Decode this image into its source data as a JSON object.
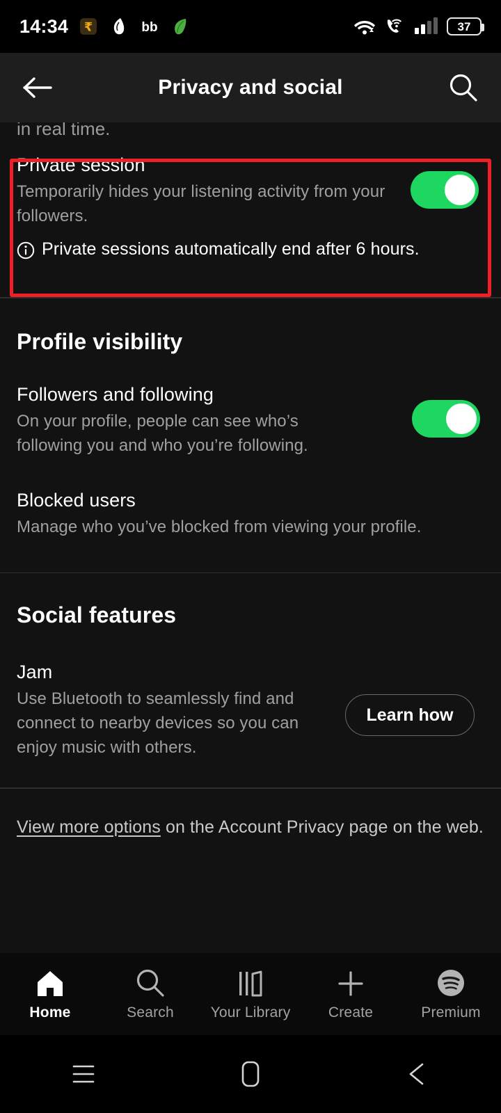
{
  "status_bar": {
    "time": "14:34",
    "left_icons": [
      "rupee-payment-icon",
      "thread-app-icon",
      "bb-app-icon",
      "leaf-app-icon"
    ],
    "right_icons": [
      "wifi-icon",
      "call-wifi-icon",
      "cellular-signal-icon"
    ],
    "battery_percent": "37"
  },
  "app_bar": {
    "back_icon": "back-arrow-icon",
    "title": "Privacy and social",
    "search_icon": "search-icon"
  },
  "content": {
    "clipped_text": "in real time.",
    "private_session": {
      "title": "Private session",
      "description": "Temporarily hides your listening activity from your followers.",
      "note": "Private sessions automatically end after 6 hours.",
      "note_icon": "info-icon",
      "toggle_on": true
    },
    "highlight_color": "#ee1f26",
    "profile_visibility": {
      "heading": "Profile visibility",
      "followers": {
        "title": "Followers and following",
        "description": "On your profile, people can see who’s following you and who you’re following.",
        "toggle_on": true
      },
      "blocked": {
        "title": "Blocked users",
        "description": "Manage who you’ve blocked from viewing your profile."
      }
    },
    "social_features": {
      "heading": "Social features",
      "jam": {
        "title": "Jam",
        "description": "Use Bluetooth to seamlessly find and connect to nearby devices so you can enjoy music with others.",
        "button_label": "Learn how"
      }
    },
    "footer": {
      "link_text": "View more options",
      "rest_text": " on the Account Privacy page on the web."
    }
  },
  "tab_bar": {
    "items": [
      {
        "label": "Home",
        "icon": "home-icon",
        "active": true
      },
      {
        "label": "Search",
        "icon": "search-icon",
        "active": false
      },
      {
        "label": "Your Library",
        "icon": "library-icon",
        "active": false
      },
      {
        "label": "Create",
        "icon": "plus-icon",
        "active": false
      },
      {
        "label": "Premium",
        "icon": "spotify-icon",
        "active": false
      }
    ]
  },
  "system_nav": {
    "items": [
      "recents-icon",
      "home-square-icon",
      "back-triangle-icon"
    ]
  },
  "colors": {
    "accent_green": "#1ed760",
    "highlight_red": "#ee1f26",
    "background": "#121212",
    "appbar": "#1e1e1e"
  }
}
